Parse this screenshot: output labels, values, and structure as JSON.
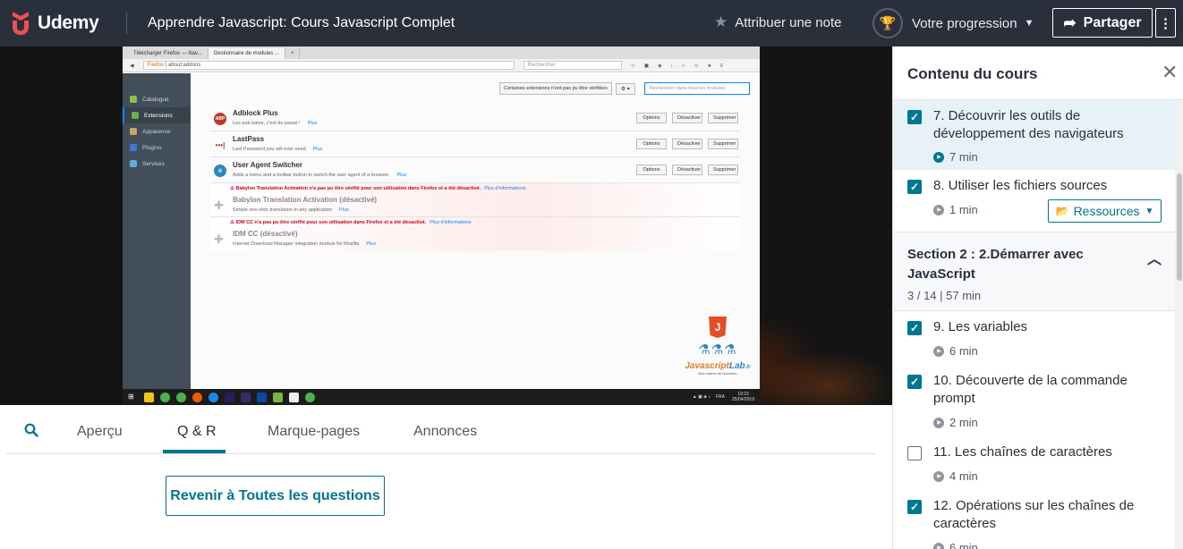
{
  "brand": {
    "name": "Udemy",
    "color": "#ec5252"
  },
  "header": {
    "course_title": "Apprendre Javascript: Cours Javascript Complet",
    "rate_label": "Attribuer une note",
    "progress_label": "Votre progression",
    "share_label": "Partager",
    "more_icon": "vertical-ellipsis-icon"
  },
  "video": {
    "firefox": {
      "tabs": [
        "Télécharger Firefox — Nav...",
        "Gestionnaire de modules ..."
      ],
      "url_brand": "Firefox",
      "url": "about:addons",
      "search_placeholder": "Rechercher",
      "sidebar": [
        "Catalogue",
        "Extensions",
        "Apparence",
        "Plugins",
        "Services"
      ],
      "warn_button": "Certaines extensions n'ont pas pu être vérifiées",
      "module_search_placeholder": "Rechercher dans tous les modules",
      "addons": [
        {
          "name": "Adblock Plus",
          "desc": "Les pub tuées, c'est du passé !",
          "more": "Plus",
          "buttons": [
            "Options",
            "Désactiver",
            "Supprimer"
          ]
        },
        {
          "name": "LastPass",
          "desc": "Last Password you will ever need",
          "more": "Plus",
          "buttons": [
            "Options",
            "Désactiver",
            "Supprimer"
          ]
        },
        {
          "name": "User Agent Switcher",
          "desc": "Adds a menu and a toolbar button to switch the user agent of a browser.",
          "more": "Plus",
          "buttons": [
            "Options",
            "Désactiver",
            "Supprimer"
          ]
        },
        {
          "warning": "Babylon Translation Activation n'a pas pu être vérifié pour son utilisation dans Firefox et a été désactivé.",
          "warning_more": "Plus d'informations",
          "name": "Babylon Translation Activation",
          "status": "(désactivé)",
          "desc": "Simple one-click translation in any application",
          "more": "Plus"
        },
        {
          "warning": "IDM CC n'a pas pu être vérifié pour son utilisation dans Firefox et a été désactivé.",
          "warning_more": "Plus d'informations",
          "name": "IDM CC",
          "status": "(désactivé)",
          "desc": "Internet Download Manager integration module for Mozilla",
          "more": "Plus"
        }
      ],
      "watermark": {
        "badge": "J",
        "name_a": "Javascript",
        "name_b": "Lab",
        "suffix": ".fr",
        "tagline": "Des cadres du Nouveau"
      },
      "taskbar": {
        "lang": "FRA",
        "time": "19:23",
        "date": "25/04/2019"
      }
    }
  },
  "tabs": {
    "search_icon": "search-icon",
    "items": [
      "Aperçu",
      "Q & R",
      "Marque-pages",
      "Annonces"
    ],
    "active": "Q & R"
  },
  "qa": {
    "back_label": "Revenir à Toutes les questions"
  },
  "sidebar": {
    "title": "Contenu du cours",
    "lectures_top": [
      {
        "title": "7. Découvrir les outils de développement des navigateurs",
        "duration": "7 min",
        "checked": true,
        "current": true
      },
      {
        "title": "8. Utiliser les fichiers sources",
        "duration": "1 min",
        "checked": true,
        "resources_label": "Ressources"
      }
    ],
    "section": {
      "title": "Section 2 : 2.Démarrer avec JavaScript",
      "meta": "3 / 14 | 57 min"
    },
    "lectures": [
      {
        "title": "9. Les variables",
        "duration": "6 min",
        "checked": true
      },
      {
        "title": "10. Découverte de la commande prompt",
        "duration": "2 min",
        "checked": true
      },
      {
        "title": "11. Les chaînes de caractères",
        "duration": "4 min",
        "checked": false
      },
      {
        "title": "12. Opérations sur les chaînes de caractères",
        "duration": "6 min",
        "checked": true
      }
    ]
  },
  "colors": {
    "topbar": "#29303b",
    "accent": "#007791",
    "current_lecture_bg": "#e6f2f5"
  }
}
